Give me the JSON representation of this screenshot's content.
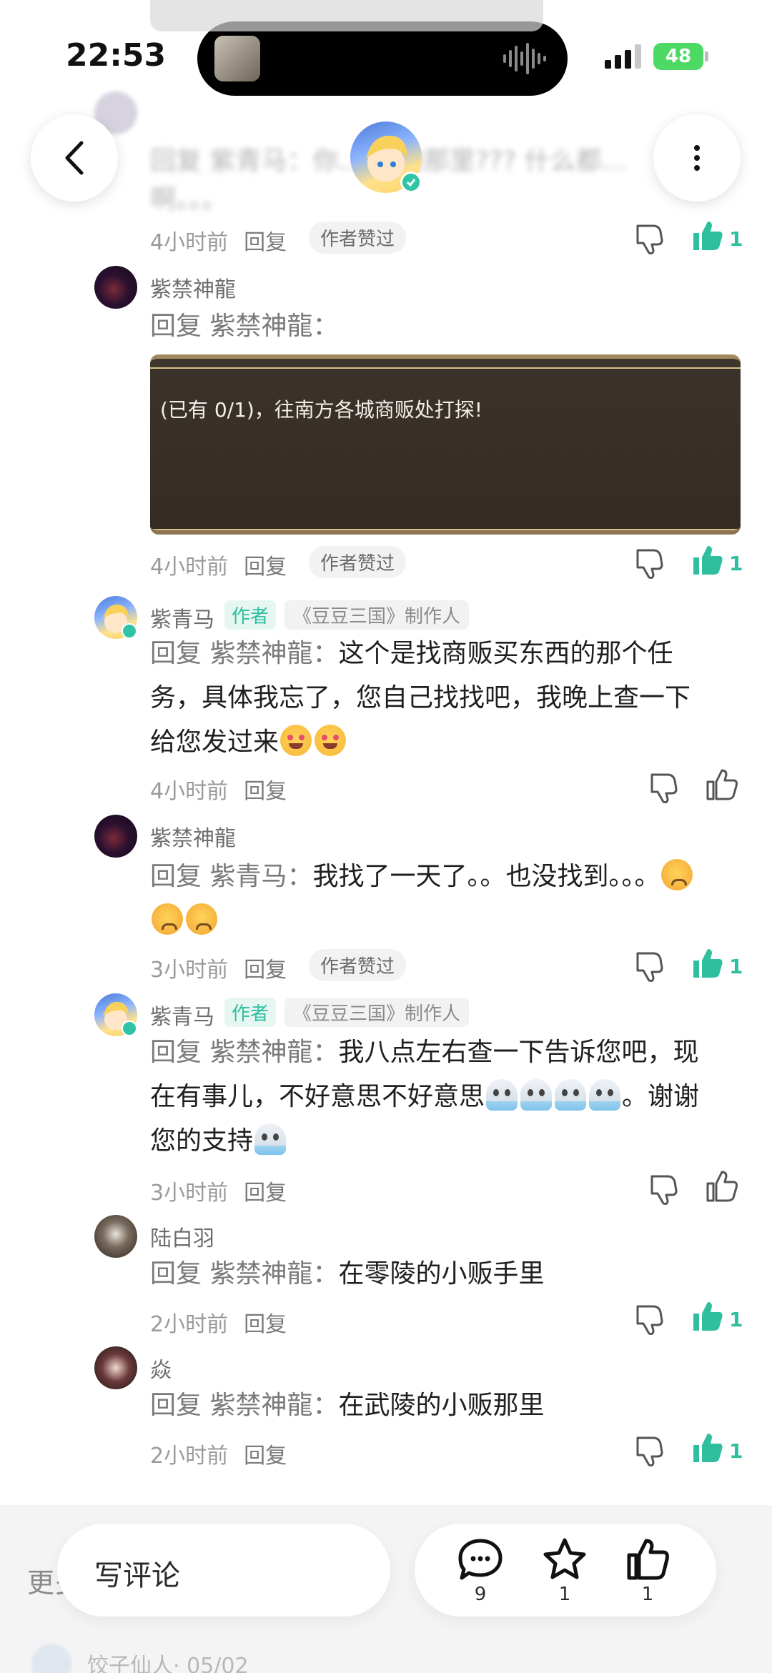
{
  "status_bar": {
    "time": "22:53",
    "battery": "48"
  },
  "faded_top": {
    "text_line1": "回复 紫青马：你… …的那里??? 什么都…",
    "text_line2": "啊。。。"
  },
  "comments": [
    {
      "id": "c0",
      "time": "4小时前",
      "reply_label": "回复",
      "liked_by_author": "作者赞过",
      "like_count": "1"
    },
    {
      "id": "c1",
      "author": "紫禁神龍",
      "reply_prefix": "回复 紫禁神龍：",
      "text": "",
      "image_text": "(已有 0/1)，往南方各城商贩处打探!",
      "time": "4小时前",
      "reply_label": "回复",
      "liked_by_author": "作者赞过",
      "like_count": "1"
    },
    {
      "id": "c2",
      "author": "紫青马",
      "author_tag": "作者",
      "role_tag": "《豆豆三国》制作人",
      "reply_prefix": "回复 紫禁神龍：",
      "text_line1": "这个是找商贩买东西的那个任",
      "text_line2": "务，具体我忘了，您自己找找吧，我晚上查一下",
      "text_line3": "给您发过来",
      "time": "4小时前",
      "reply_label": "回复"
    },
    {
      "id": "c3",
      "author": "紫禁神龍",
      "reply_prefix": "回复 紫青马：",
      "text_line1": "我找了一天了。。也没找到。。。",
      "time": "3小时前",
      "reply_label": "回复",
      "liked_by_author": "作者赞过",
      "like_count": "1"
    },
    {
      "id": "c4",
      "author": "紫青马",
      "author_tag": "作者",
      "role_tag": "《豆豆三国》制作人",
      "reply_prefix": "回复 紫禁神龍：",
      "text_line1": "我八点左右查一下告诉您吧，现",
      "text_line2": "在有事儿，不好意思不好意思",
      "text_line2_after": "。谢谢",
      "text_line3": "您的支持",
      "time": "3小时前",
      "reply_label": "回复"
    },
    {
      "id": "c5",
      "author": "陆白羽",
      "reply_prefix": "回复 紫禁神龍：",
      "text_line1": "在零陵的小贩手里",
      "time": "2小时前",
      "reply_label": "回复",
      "like_count": "1"
    },
    {
      "id": "c6",
      "author": "焱",
      "reply_prefix": "回复 紫禁神龍：",
      "text_line1": "在武陵的小贩那里",
      "time": "2小时前",
      "reply_label": "回复",
      "like_count": "1"
    }
  ],
  "bottom": {
    "more_label": "更多",
    "write_comment": "写评论",
    "comment_count": "9",
    "favorite_count": "1",
    "like_count": "1",
    "next_author": "饺子仙人",
    "next_date": "· 05/02"
  },
  "colors": {
    "accent": "#2fbf9f",
    "muted": "#9a9a9a"
  }
}
